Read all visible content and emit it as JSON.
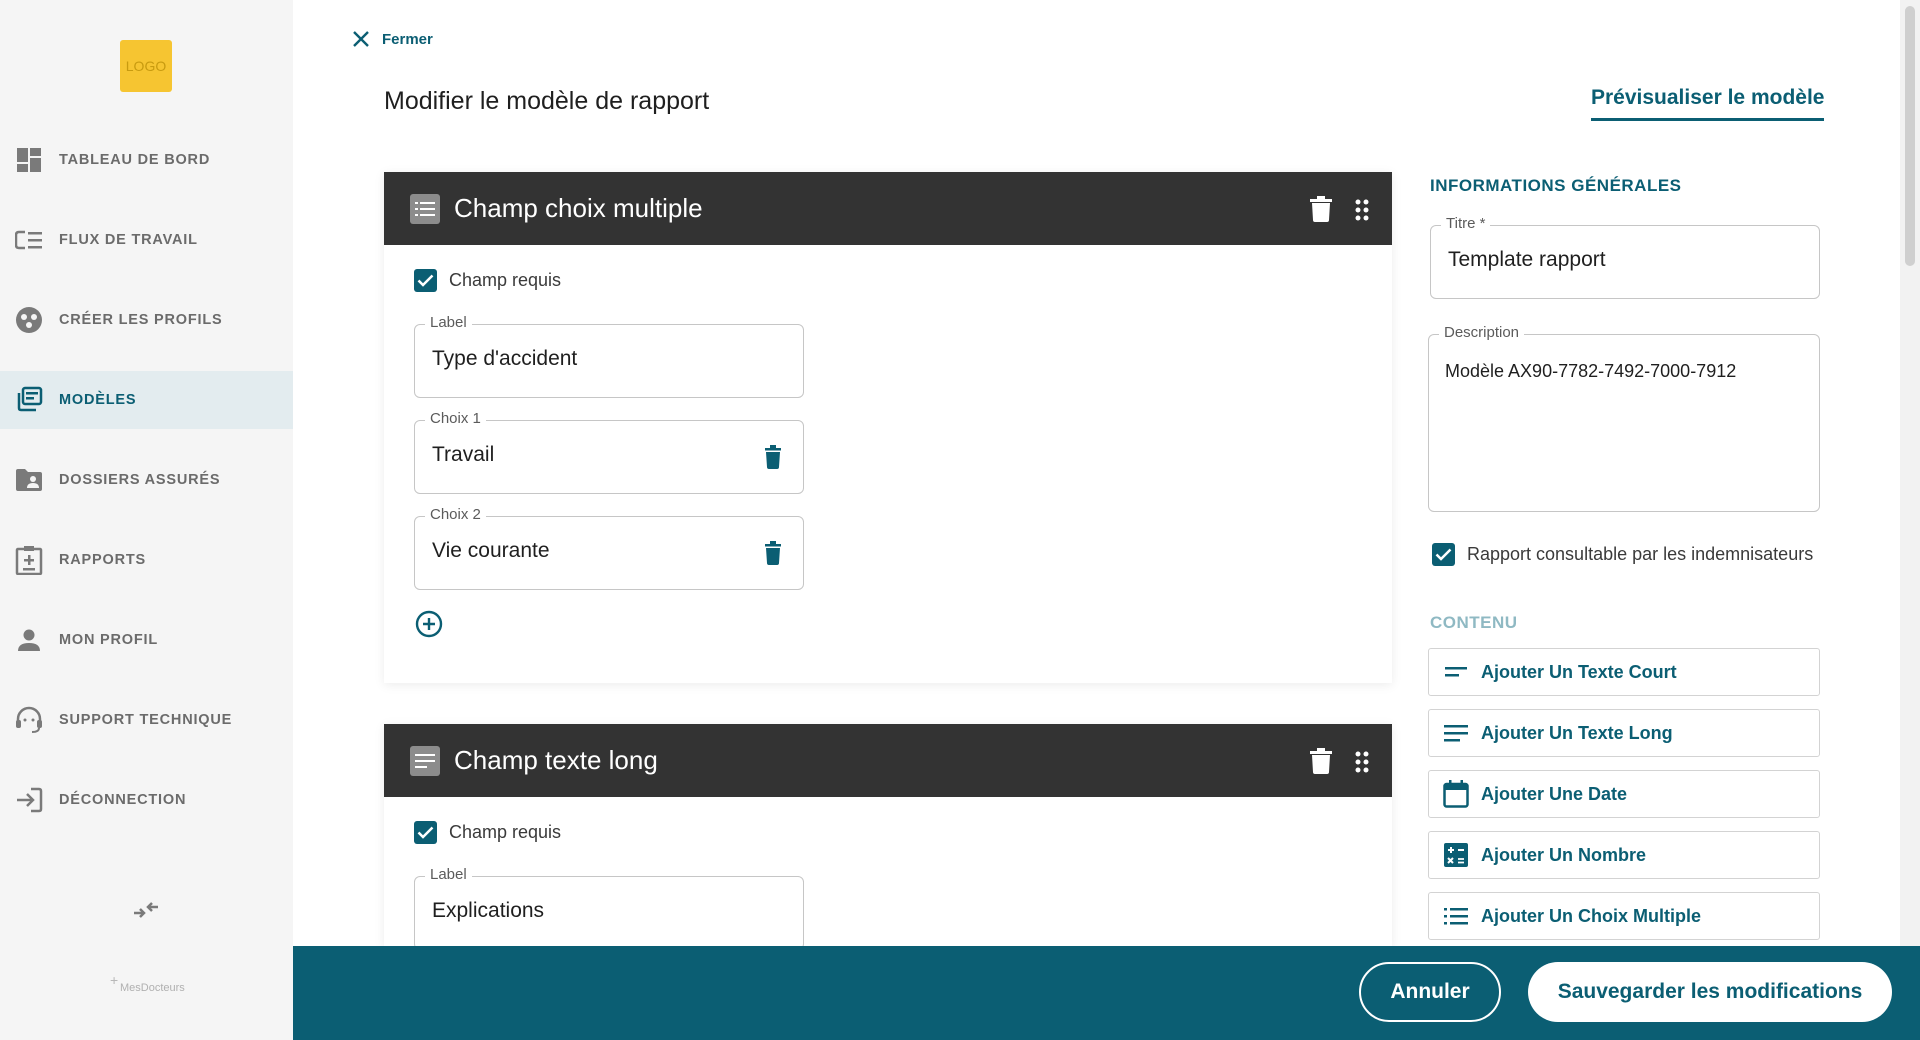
{
  "sidebar": {
    "logo_text": "LOGO",
    "items": [
      {
        "label": "TABLEAU DE BORD",
        "icon": "dashboard-icon"
      },
      {
        "label": "FLUX DE TRAVAIL",
        "icon": "workflow-icon"
      },
      {
        "label": "CRÉER LES PROFILS",
        "icon": "profiles-icon"
      },
      {
        "label": "MODÈLES",
        "icon": "templates-icon",
        "active": true
      },
      {
        "label": "DOSSIERS ASSURÉS",
        "icon": "folder-icon"
      },
      {
        "label": "RAPPORTS",
        "icon": "report-icon"
      },
      {
        "label": "MON PROFIL",
        "icon": "person-icon"
      },
      {
        "label": "SUPPORT TECHNIQUE",
        "icon": "support-icon"
      },
      {
        "label": "DÉCONNECTION",
        "icon": "logout-icon"
      }
    ],
    "brand": {
      "plus": "+",
      "name": "MesDocteurs"
    }
  },
  "header": {
    "close_label": "Fermer",
    "title": "Modifier le modèle de rapport",
    "preview_label": "Prévisualiser le modèle"
  },
  "cards": [
    {
      "title": "Champ choix multiple",
      "required_label": "Champ requis",
      "label_legend": "Label",
      "label_value": "Type d'accident",
      "choices": [
        {
          "legend": "Choix 1",
          "value": "Travail"
        },
        {
          "legend": "Choix 2",
          "value": "Vie courante"
        }
      ]
    },
    {
      "title": "Champ texte long",
      "required_label": "Champ requis",
      "label_legend": "Label",
      "label_value": "Explications"
    }
  ],
  "panel": {
    "general_heading": "INFORMATIONS GÉNÉRALES",
    "title_legend": "Titre *",
    "title_value": "Template rapport",
    "description_legend": "Description",
    "description_value": "Modèle AX90-7782-7492-7000-7912",
    "consultable_label": "Rapport consultable par les indemnisateurs",
    "content_heading": "CONTENU",
    "add_buttons": [
      {
        "label": "Ajouter Un Texte Court",
        "icon": "short-text-icon"
      },
      {
        "label": "Ajouter Un Texte Long",
        "icon": "long-text-icon"
      },
      {
        "label": "Ajouter Une Date",
        "icon": "calendar-icon"
      },
      {
        "label": "Ajouter Un Nombre",
        "icon": "calculator-icon"
      },
      {
        "label": "Ajouter Un Choix Multiple",
        "icon": "list-icon"
      }
    ]
  },
  "footer": {
    "cancel_label": "Annuler",
    "save_label": "Sauvegarder les modifications"
  },
  "colors": {
    "primary": "#0b5e73",
    "header_dark": "#333333",
    "logo": "#f6c531"
  }
}
